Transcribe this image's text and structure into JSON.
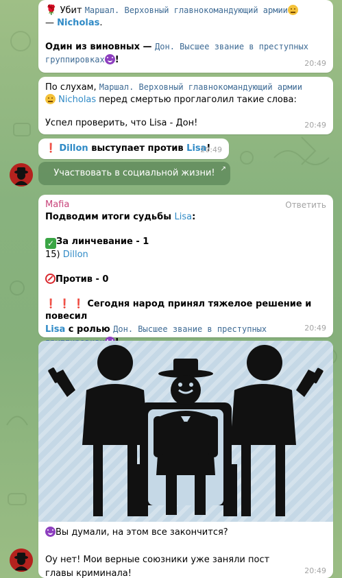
{
  "messages": [
    {
      "id": "msg1",
      "line1_prefix": "Убит",
      "line1_mono": "Маршал. Верховный главнокомандующий армии",
      "line2_dash": "—",
      "line2_name": "Nicholas",
      "line2_end": ".",
      "line3_prefix": "Один из виновных — ",
      "line3_mono": "Дон. Высшее звание в преступных группировках",
      "line3_end": "!",
      "time": "20:49"
    },
    {
      "id": "msg2",
      "line1_prefix": "По слухам, ",
      "line1_mono": "Маршал. Верховный главнокомандующий армии",
      "line2_name": "Nicholas",
      "line2_rest": " перед смертью проглаголил такие слова:",
      "line3": "Успел проверить, что Lisa - Дон!",
      "time": "20:49"
    },
    {
      "id": "msg3",
      "attacker": "Dillon",
      "middle": " выступает против ",
      "target": "Lisa",
      "end": "!",
      "time": "20:49"
    },
    {
      "id": "msg4",
      "sender": "Mafia",
      "reply_label": "Ответить",
      "line1_prefix": "Подводим итоги судьбы ",
      "line1_name": "Lisa",
      "line1_end": ":",
      "for_label": "За линчевание - 1",
      "voter_num": "15) ",
      "voter_name": "Dillon",
      "against_label": "Против - 0",
      "verdict_prefix": " Сегодня народ принял тяжелое решение и повесил",
      "verdict_name": "Lisa",
      "verdict_role_prefix": " с ролью ",
      "verdict_role": "Дон. Высшее звание в преступных группировках",
      "verdict_end": "!",
      "time": "20:49"
    },
    {
      "id": "msg5",
      "line1": "Вы думали, на этом все закончится?",
      "line2": "Оу нет! Мои верные союзники уже заняли пост главы криминала!",
      "time": "20:49"
    }
  ],
  "inline_button": {
    "label": "Участвовать в социальной жизни!",
    "arrow": "↗"
  },
  "colors": {
    "link": "#2f8ac6",
    "mono": "#3d6a94",
    "sender": "#c8437a",
    "time": "#a3a3a3",
    "background": "#8fb57f"
  }
}
